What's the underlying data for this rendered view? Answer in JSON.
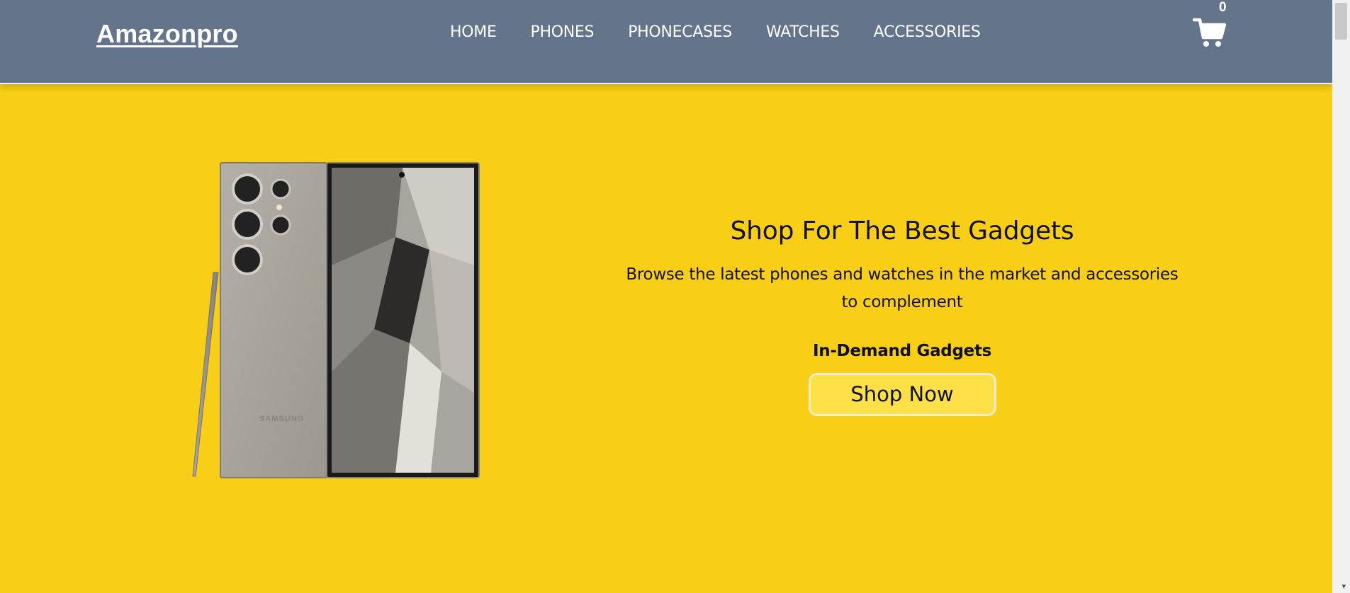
{
  "header": {
    "logo": "Amazonpro",
    "nav": [
      "HOME",
      "PHONES",
      "PHONECASES",
      "WATCHES",
      "ACCESSORIES"
    ],
    "cart_count": "0",
    "cart_icon": "shopping-cart-icon"
  },
  "hero": {
    "title": "Shop For The Best Gadgets",
    "description": "Browse the latest phones and watches in the market and accessories to complement",
    "subheading": "In-Demand Gadgets",
    "button_label": "Shop Now",
    "image_text": "SAMSUNG"
  },
  "colors": {
    "navbar_bg": "#64748b",
    "page_bg": "#f9ce16",
    "button_bg": "#fde047"
  }
}
